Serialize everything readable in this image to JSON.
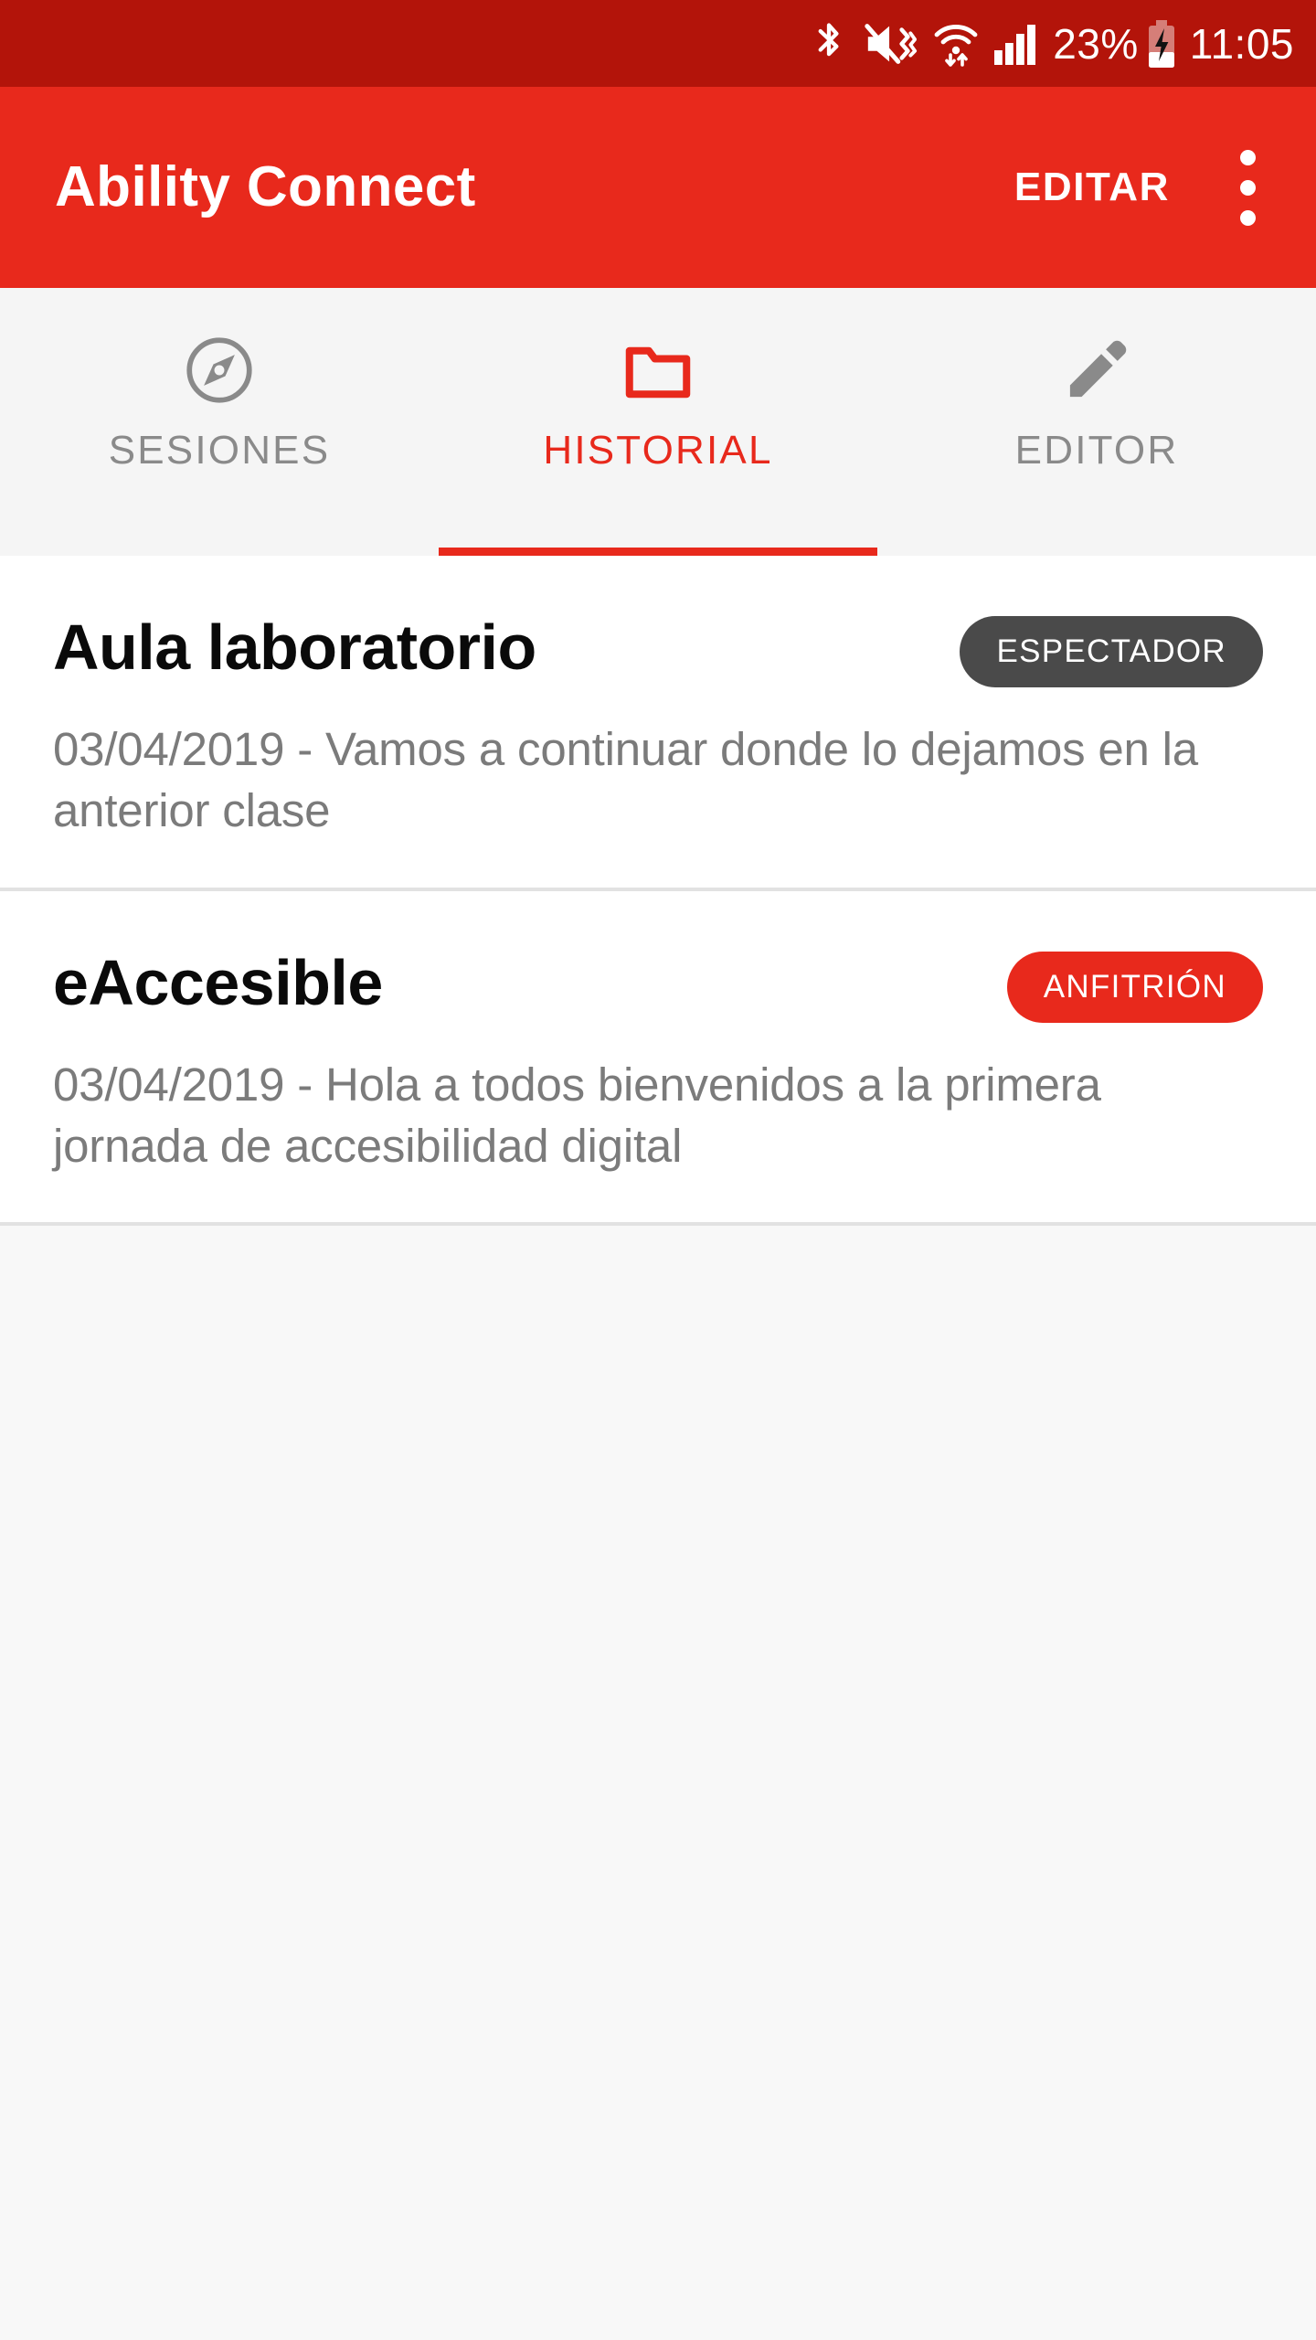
{
  "colors": {
    "status_bar_bg": "#B3140A",
    "app_bar_bg": "#E8291C",
    "accent": "#E8291C",
    "tab_bar_bg": "#f5f5f5",
    "inactive_tab": "#8a8a8a",
    "viewer_badge": "#4a4a4a",
    "host_badge": "#E8291C",
    "subtitle": "#7b7b7b",
    "divider": "#e2e2e2",
    "empty_area": "#f8f8f8"
  },
  "status_bar": {
    "icons": [
      "bluetooth-icon",
      "mute-vibrate-icon",
      "wifi-icon",
      "signal-icon",
      "battery-charging-icon"
    ],
    "battery_percent": "23%",
    "time": "11:05"
  },
  "app_bar": {
    "title": "Ability Connect",
    "action_label": "EDITAR",
    "overflow_icon": "more-vert-icon"
  },
  "tabs": [
    {
      "label": "SESIONES",
      "icon": "compass-icon",
      "active": false
    },
    {
      "label": "HISTORIAL",
      "icon": "folder-icon",
      "active": true
    },
    {
      "label": "EDITOR",
      "icon": "pencil-icon",
      "active": false
    }
  ],
  "history": {
    "items": [
      {
        "title": "Aula laboratorio",
        "badge": "ESPECTADOR",
        "badge_role": "viewer",
        "date": "03/04/2019",
        "subtitle": "03/04/2019 - Vamos a continuar donde lo dejamos en la anterior clase"
      },
      {
        "title": "eAccesible",
        "badge": "ANFITRIÓN",
        "badge_role": "host",
        "date": "03/04/2019",
        "subtitle": "03/04/2019 - Hola a todos bienvenidos a la primera jornada de accesibilidad digital"
      }
    ]
  }
}
